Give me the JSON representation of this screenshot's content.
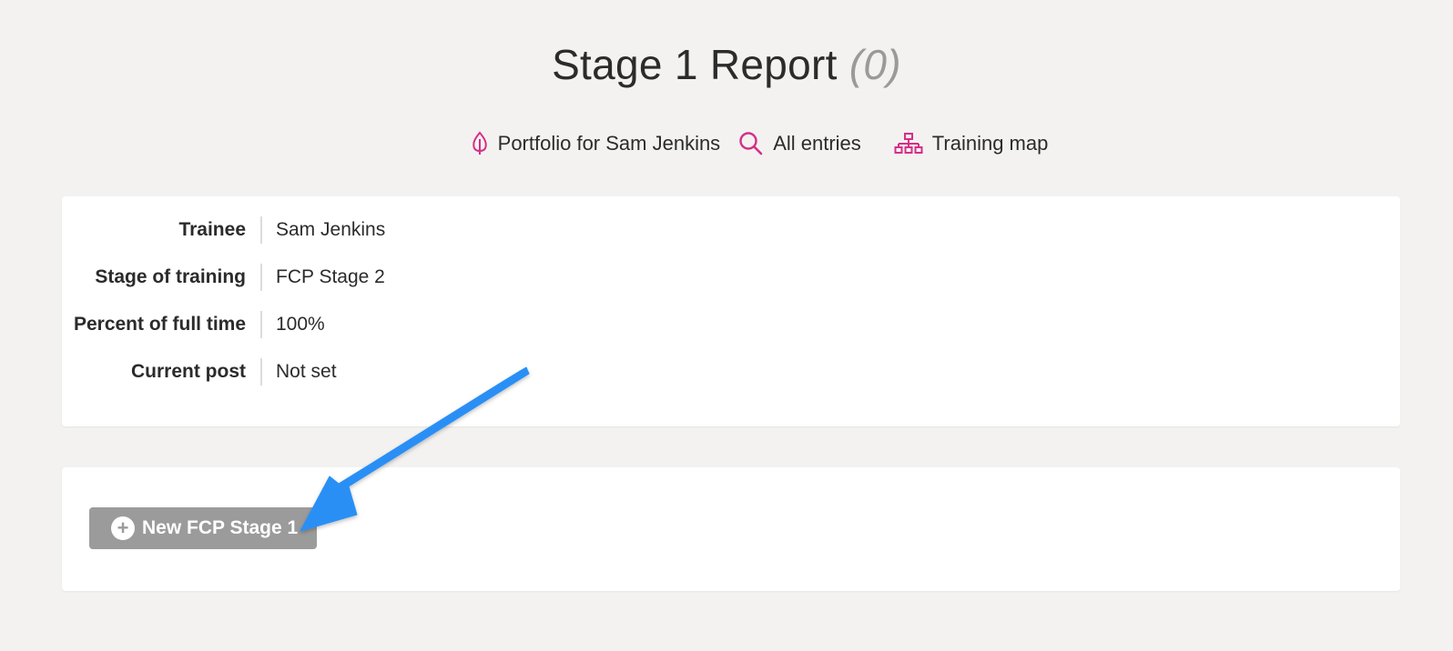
{
  "header": {
    "title": "Stage 1 Report",
    "count": "(0)"
  },
  "nav": {
    "portfolio": {
      "label": "Portfolio for Sam Jenkins",
      "icon": "leaf-icon"
    },
    "entries": {
      "label": "All entries",
      "icon": "search-icon"
    },
    "training_map": {
      "label": "Training map",
      "icon": "sitemap-icon"
    }
  },
  "info": {
    "rows": [
      {
        "label": "Trainee",
        "value": "Sam Jenkins"
      },
      {
        "label": "Stage of training",
        "value": "FCP Stage 2"
      },
      {
        "label": "Percent of full time",
        "value": "100%"
      },
      {
        "label": "Current post",
        "value": "Not set"
      }
    ]
  },
  "actions": {
    "new_button_label": "New FCP Stage 1",
    "new_button_icon": "plus-circle-icon"
  },
  "colors": {
    "accent": "#d62f86",
    "button_bg": "#9b9b9b",
    "arrow": "#2a8ff5",
    "page_bg": "#f3f2f1"
  }
}
